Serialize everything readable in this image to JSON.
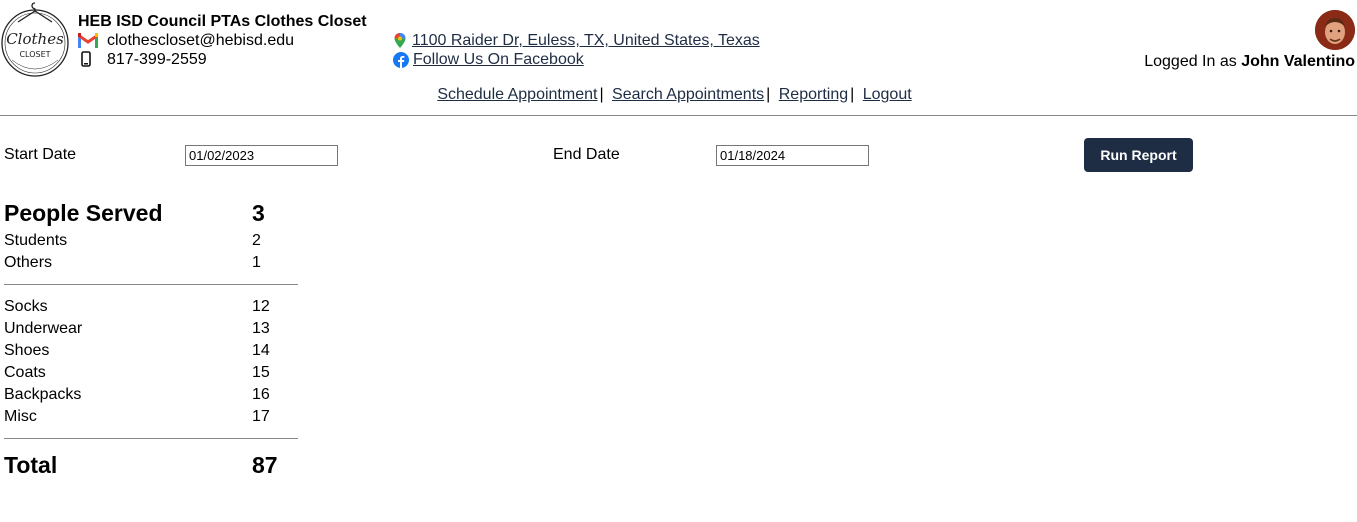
{
  "header": {
    "org_name": "HEB ISD Council PTAs Clothes Closet",
    "email": "clothescloset@hebisd.edu",
    "phone": "817-399-2559",
    "address": "1100 Raider Dr, Euless, TX, United States, Texas",
    "facebook": "Follow Us On Facebook",
    "logged_in_prefix": "Logged In as",
    "user_name": "John Valentino"
  },
  "nav": {
    "schedule": "Schedule Appointment",
    "search": "Search Appointments",
    "reporting": "Reporting",
    "logout": "Logout",
    "separator": "|"
  },
  "report_form": {
    "start_label": "Start Date",
    "start_value": "01/02/2023",
    "end_label": "End Date",
    "end_value": "01/18/2024",
    "run_label": "Run Report"
  },
  "report": {
    "people_served": {
      "label": "People Served",
      "value": "3"
    },
    "students": {
      "label": "Students",
      "value": "2"
    },
    "others": {
      "label": "Others",
      "value": "1"
    },
    "items": [
      {
        "label": "Socks",
        "value": "12"
      },
      {
        "label": "Underwear",
        "value": "13"
      },
      {
        "label": "Shoes",
        "value": "14"
      },
      {
        "label": "Coats",
        "value": "15"
      },
      {
        "label": "Backpacks",
        "value": "16"
      },
      {
        "label": "Misc",
        "value": "17"
      }
    ],
    "total": {
      "label": "Total",
      "value": "87"
    }
  },
  "colors": {
    "accent": "#1f2d44",
    "divider": "#888888"
  }
}
